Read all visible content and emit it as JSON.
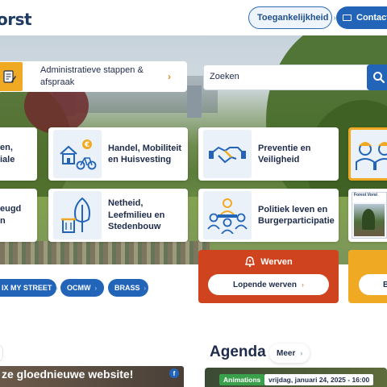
{
  "header": {
    "logo_text": "orst",
    "accessibility_label": "Toegankelijkheid",
    "contact_label": "Contacte"
  },
  "quick_actions": {
    "admin_label": "Administratieve stappen & afspraak"
  },
  "search": {
    "value": "Zoeken"
  },
  "tiles": [
    {
      "label": "en,\niale",
      "icon": "partial-icon"
    },
    {
      "label": "Handel, Mobiliteit en Huisvesting",
      "icon": "house-bike-euro-icon"
    },
    {
      "label": "Preventie en Veiligheid",
      "icon": "handshake-icon"
    },
    {
      "label": "",
      "icon": "workers-icon"
    },
    {
      "label": "eugd\nn",
      "icon": "partial-icon"
    },
    {
      "label": "Netheid, Leefmilieu en Stedenbouw",
      "icon": "tree-bin-icon"
    },
    {
      "label": "Politiek leven en Burgerparticipatie",
      "icon": "meeting-people-icon"
    },
    {
      "label": "Forest Vorst",
      "icon": "magazine-cover"
    }
  ],
  "quick_links": [
    {
      "label": "IX MY STREET"
    },
    {
      "label": "OCMW"
    },
    {
      "label": "BRASS"
    }
  ],
  "werven": {
    "title": "Werven",
    "button_label": "Lopende werven"
  },
  "yellow_tile": {
    "button_label": "B"
  },
  "news": {
    "title": "ze gloednieuwe website!"
  },
  "agenda": {
    "heading": "Agenda",
    "more_label": "Meer",
    "badge": "Animations",
    "date": "vrijdag, januari 24, 2025 - 16:00"
  },
  "colors": {
    "primary_blue": "#2264b8",
    "accent_orange": "#f0a922",
    "werven_red": "#d0431f",
    "text_dark": "#1e2b4a"
  }
}
